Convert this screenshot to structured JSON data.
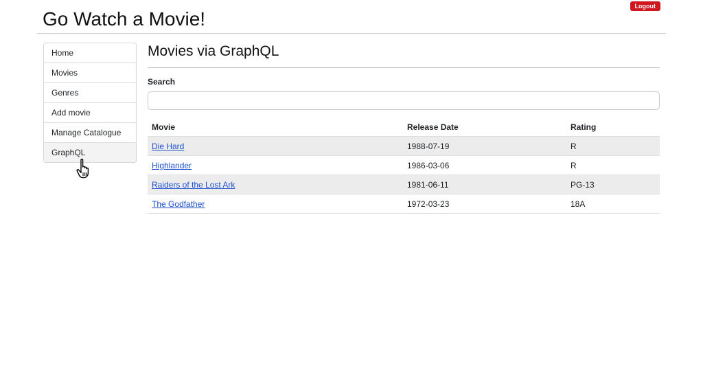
{
  "header": {
    "title": "Go Watch a Movie!",
    "logout_label": "Logout"
  },
  "sidebar": {
    "items": [
      {
        "label": "Home"
      },
      {
        "label": "Movies"
      },
      {
        "label": "Genres"
      },
      {
        "label": "Add movie"
      },
      {
        "label": "Manage Catalogue"
      },
      {
        "label": "GraphQL"
      }
    ],
    "active_index": 5
  },
  "main": {
    "title": "Movies via GraphQL",
    "search": {
      "label": "Search",
      "value": "",
      "placeholder": ""
    },
    "table": {
      "columns": [
        "Movie",
        "Release Date",
        "Rating"
      ],
      "rows": [
        {
          "title": "Die Hard",
          "release_date": "1988-07-19",
          "rating": "R"
        },
        {
          "title": "Highlander",
          "release_date": "1986-03-06",
          "rating": "R"
        },
        {
          "title": "Raiders of the Lost Ark",
          "release_date": "1981-06-11",
          "rating": "PG-13"
        },
        {
          "title": "The Godfather",
          "release_date": "1972-03-23",
          "rating": "18A"
        }
      ]
    }
  },
  "colors": {
    "logout": "#d0161f",
    "link": "#1d4fd1",
    "stripe": "#ececec"
  },
  "cursor_icon": "hand-pointer-icon"
}
